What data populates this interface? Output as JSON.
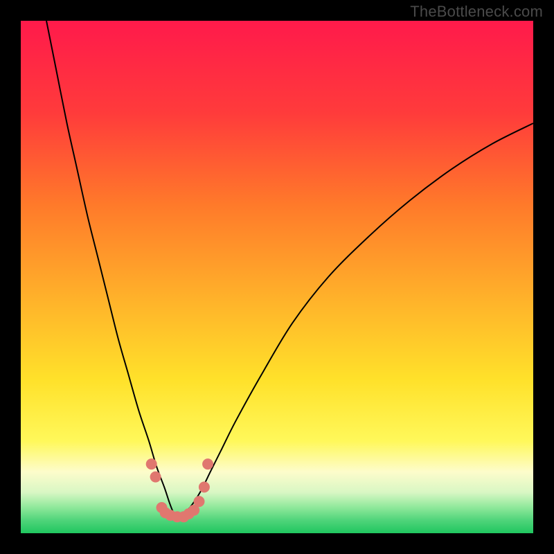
{
  "watermark": "TheBottleneck.com",
  "chart_data": {
    "type": "line",
    "title": "",
    "xlabel": "",
    "ylabel": "",
    "xlim": [
      0,
      100
    ],
    "ylim": [
      0,
      100
    ],
    "grid": false,
    "legend": false,
    "background_gradient_stops": [
      {
        "offset": 0.0,
        "color": "#ff1a4b"
      },
      {
        "offset": 0.18,
        "color": "#ff3b3b"
      },
      {
        "offset": 0.36,
        "color": "#ff7a2a"
      },
      {
        "offset": 0.55,
        "color": "#ffb42a"
      },
      {
        "offset": 0.7,
        "color": "#ffe12a"
      },
      {
        "offset": 0.82,
        "color": "#fff85a"
      },
      {
        "offset": 0.88,
        "color": "#fdfccb"
      },
      {
        "offset": 0.92,
        "color": "#d9f7c4"
      },
      {
        "offset": 0.95,
        "color": "#8ee89a"
      },
      {
        "offset": 0.975,
        "color": "#4fd47a"
      },
      {
        "offset": 1.0,
        "color": "#1fc65f"
      }
    ],
    "series": [
      {
        "name": "bottleneck-curve",
        "color": "#000000",
        "stroke_width": 2,
        "x": [
          5,
          7,
          9,
          11,
          13,
          15,
          17,
          19,
          21,
          23,
          25,
          26.5,
          28,
          29,
          29.8,
          30.5,
          31.5,
          33,
          35,
          37,
          39,
          42,
          47,
          53,
          60,
          68,
          76,
          84,
          92,
          100
        ],
        "y": [
          100,
          90,
          80,
          71,
          62,
          54,
          46,
          38,
          31,
          24,
          18,
          13,
          9,
          6,
          4,
          3,
          3.5,
          5,
          8,
          12,
          16,
          22,
          31,
          41,
          50,
          58,
          65,
          71,
          76,
          80
        ]
      },
      {
        "name": "highlight-dots",
        "color": "#e0776f",
        "marker_radius": 8,
        "points": [
          {
            "x": 25.5,
            "y": 13.5
          },
          {
            "x": 26.3,
            "y": 11.0
          },
          {
            "x": 27.5,
            "y": 5.0
          },
          {
            "x": 28.2,
            "y": 4.0
          },
          {
            "x": 29.2,
            "y": 3.5
          },
          {
            "x": 30.5,
            "y": 3.2
          },
          {
            "x": 31.8,
            "y": 3.2
          },
          {
            "x": 32.8,
            "y": 3.8
          },
          {
            "x": 33.8,
            "y": 4.5
          },
          {
            "x": 34.8,
            "y": 6.2
          },
          {
            "x": 35.8,
            "y": 9.0
          },
          {
            "x": 36.5,
            "y": 13.5
          }
        ]
      }
    ]
  }
}
